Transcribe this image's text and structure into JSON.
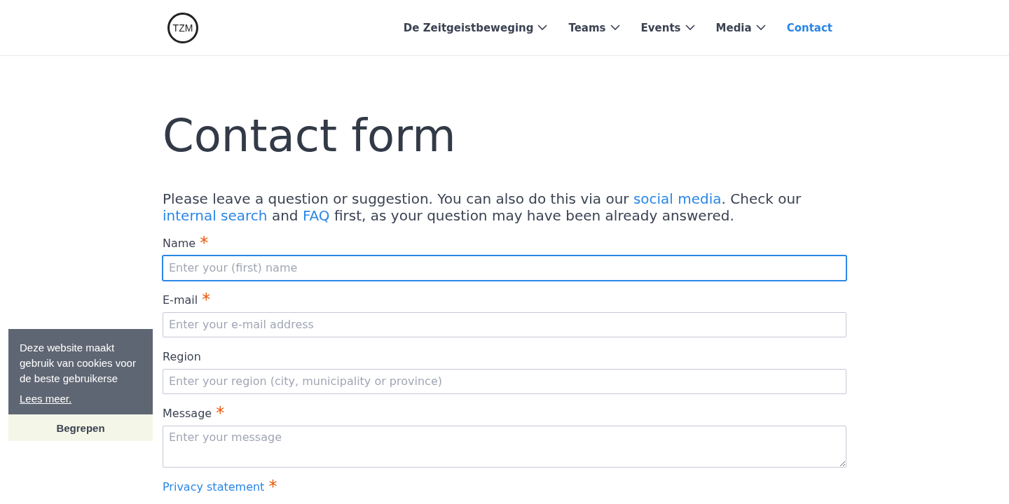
{
  "header": {
    "logo": "TZM",
    "nav": [
      {
        "label": "De Zeitgeistbeweging",
        "dropdown": true,
        "selected": false
      },
      {
        "label": "Teams",
        "dropdown": true,
        "selected": false
      },
      {
        "label": "Events",
        "dropdown": true,
        "selected": false
      },
      {
        "label": "Media",
        "dropdown": true,
        "selected": false
      },
      {
        "label": "Contact",
        "dropdown": false,
        "selected": true
      }
    ]
  },
  "title": "Contact form",
  "intro": [
    {
      "text": "Please leave a question or suggestion. You can also do this via our ",
      "link": false
    },
    {
      "text": "social media",
      "link": true
    },
    {
      "text": ". Check our ",
      "link": false
    },
    {
      "text": "internal search",
      "link": true
    },
    {
      "text": " and ",
      "link": false
    },
    {
      "text": "FAQ",
      "link": true
    },
    {
      "text": " first, as your question may have been already answered.",
      "link": false
    }
  ],
  "form": {
    "fields": [
      {
        "kind": "input",
        "label": "Name",
        "required": "*",
        "placeholder": "Enter your (first) name",
        "focused": true
      },
      {
        "kind": "input",
        "label": "E-mail",
        "required": "*",
        "placeholder": "Enter your e-mail address",
        "focused": false
      },
      {
        "kind": "input",
        "label": "Region",
        "placeholder": "Enter your region (city, municipality or province)",
        "focused": false
      },
      {
        "kind": "textarea",
        "label": "Message",
        "required": "*",
        "placeholder": "Enter your message",
        "focused": false
      }
    ],
    "privacy": {
      "label": "Privacy statement",
      "required": "*"
    }
  },
  "cookie_banner": {
    "text": "Deze website maakt gebruik van cookies voor de beste gebruikerse",
    "link": "Lees meer.",
    "button": "Begrepen"
  }
}
